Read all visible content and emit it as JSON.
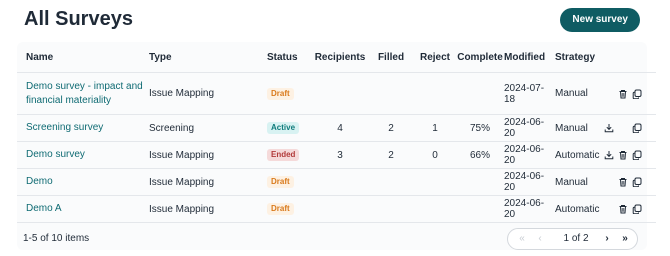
{
  "page": {
    "title": "All Surveys",
    "new_button": "New survey"
  },
  "table": {
    "columns": {
      "name": "Name",
      "type": "Type",
      "status": "Status",
      "recipients": "Recipients",
      "filled": "Filled",
      "reject": "Reject",
      "complete": "Complete",
      "modified": "Modified",
      "strategy": "Strategy"
    },
    "rows": [
      {
        "name": "Demo survey - impact and financial materiality",
        "type": "Issue Mapping",
        "status": "Draft",
        "recipients": "",
        "filled": "",
        "reject": "",
        "complete": "",
        "modified": "2024-07-18",
        "strategy": "Manual",
        "actions": [
          "trash-icon",
          "copy-icon"
        ]
      },
      {
        "name": "Screening survey",
        "type": "Screening",
        "status": "Active",
        "recipients": "4",
        "filled": "2",
        "reject": "1",
        "complete": "75%",
        "modified": "2024-06-20",
        "strategy": "Manual",
        "actions": [
          "download-icon",
          "copy-icon"
        ]
      },
      {
        "name": "Demo survey",
        "type": "Issue Mapping",
        "status": "Ended",
        "recipients": "3",
        "filled": "2",
        "reject": "0",
        "complete": "66%",
        "modified": "2024-06-20",
        "strategy": "Automatic",
        "actions": [
          "download-icon",
          "trash-icon",
          "copy-icon"
        ]
      },
      {
        "name": "Demo",
        "type": "Issue Mapping",
        "status": "Draft",
        "recipients": "",
        "filled": "",
        "reject": "",
        "complete": "",
        "modified": "2024-06-20",
        "strategy": "Manual",
        "actions": [
          "trash-icon",
          "copy-icon"
        ]
      },
      {
        "name": "Demo A",
        "type": "Issue Mapping",
        "status": "Draft",
        "recipients": "",
        "filled": "",
        "reject": "",
        "complete": "",
        "modified": "2024-06-20",
        "strategy": "Automatic",
        "actions": [
          "trash-icon",
          "copy-icon"
        ]
      }
    ]
  },
  "footer": {
    "count_text": "1-5 of 10 items",
    "page_text": "1 of 2",
    "first": "«",
    "prev": "‹",
    "next": "›",
    "last": "»"
  },
  "colors": {
    "accent": "#0f5c63",
    "link": "#0f6b73"
  }
}
